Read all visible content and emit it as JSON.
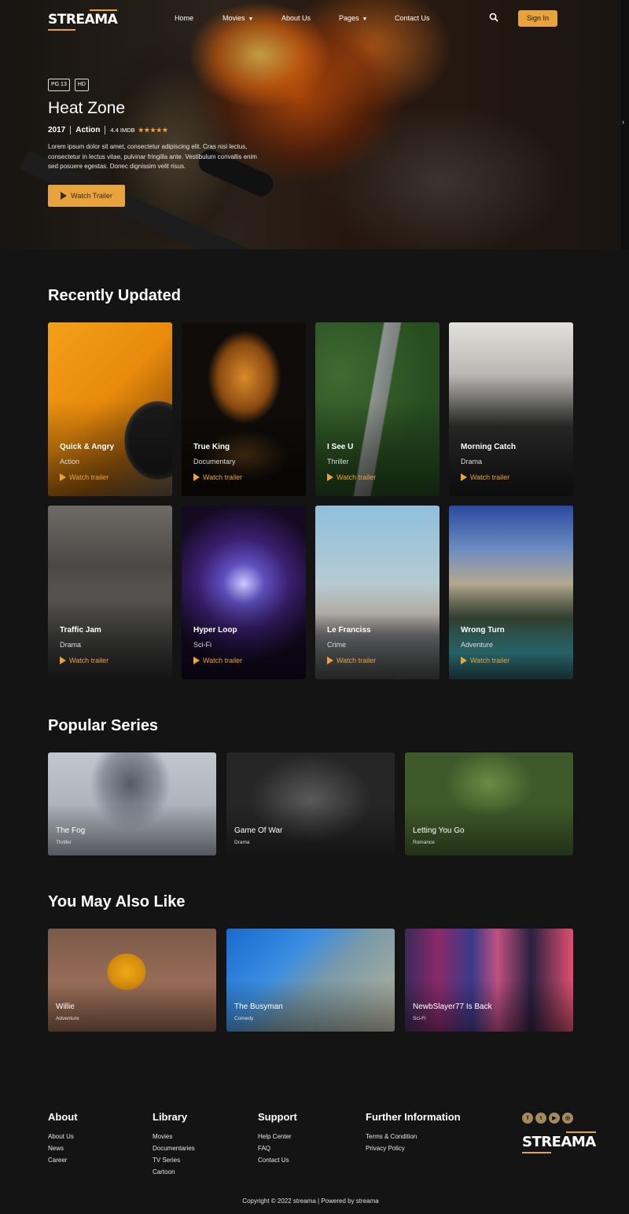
{
  "nav": {
    "logo": "STREAMA",
    "links": [
      "Home",
      "Movies",
      "About Us",
      "Pages",
      "Contact Us"
    ],
    "signin_label": "Sign In",
    "search_icon": "search-icon"
  },
  "hero": {
    "tags": [
      "PG 13",
      "HD"
    ],
    "title": "Heat Zone",
    "year": "2017",
    "genre": "Action",
    "imdb": "4.4 IMDB",
    "rating_stars": 5,
    "description": "Lorem ipsum dolor sit amet, consectetur adipiscing elit. Cras nisi lectus, consectetur in lectus vitae, pulvinar fringilla ante. Vestibulum convallis enim sed posuere egestas. Donec dignissim velit risus.",
    "button": "Watch Trailer"
  },
  "recent": {
    "title": "Recently Updated",
    "trailer_label": "Watch trailer",
    "items": [
      {
        "title": "Quick & Angry",
        "genre": "Action"
      },
      {
        "title": "True King",
        "genre": "Documentary"
      },
      {
        "title": "I See U",
        "genre": "Thriller"
      },
      {
        "title": "Morning Catch",
        "genre": "Drama"
      },
      {
        "title": "Traffic Jam",
        "genre": "Drama"
      },
      {
        "title": "Hyper Loop",
        "genre": "Sci-Fi"
      },
      {
        "title": "Le Franciss",
        "genre": "Crime"
      },
      {
        "title": "Wrong Turn",
        "genre": "Adventure"
      }
    ]
  },
  "popular": {
    "title": "Popular Series",
    "items": [
      {
        "title": "The Fog",
        "genre": "Thriller"
      },
      {
        "title": "Game Of War",
        "genre": "Drama"
      },
      {
        "title": "Letting You Go",
        "genre": "Romance"
      }
    ]
  },
  "also": {
    "title": "You May Also Like",
    "items": [
      {
        "title": "Willie",
        "genre": "Adventure"
      },
      {
        "title": "The Busyman",
        "genre": "Comedy"
      },
      {
        "title": "NewbSlayer77 Is Back",
        "genre": "Sci-Fi"
      }
    ]
  },
  "footer": {
    "about": {
      "title": "About",
      "links": [
        "About Us",
        "News",
        "Career"
      ]
    },
    "library": {
      "title": "Library",
      "links": [
        "Movies",
        "Documentaries",
        "TV Series",
        "Cartoon"
      ]
    },
    "support": {
      "title": "Support",
      "links": [
        "Help Center",
        "FAQ",
        "Contact Us"
      ]
    },
    "further": {
      "title": "Further Information",
      "links": [
        "Terms & Condition",
        "Privacy Policy"
      ]
    },
    "socials": [
      "facebook-icon",
      "twitter-icon",
      "youtube-icon",
      "dribbble-icon"
    ],
    "logo": "STREAMA",
    "copyright": "Copyright © 2022 streama | Powered by streama"
  },
  "colors": {
    "accent": "#e8a33c",
    "background": "#141414"
  }
}
